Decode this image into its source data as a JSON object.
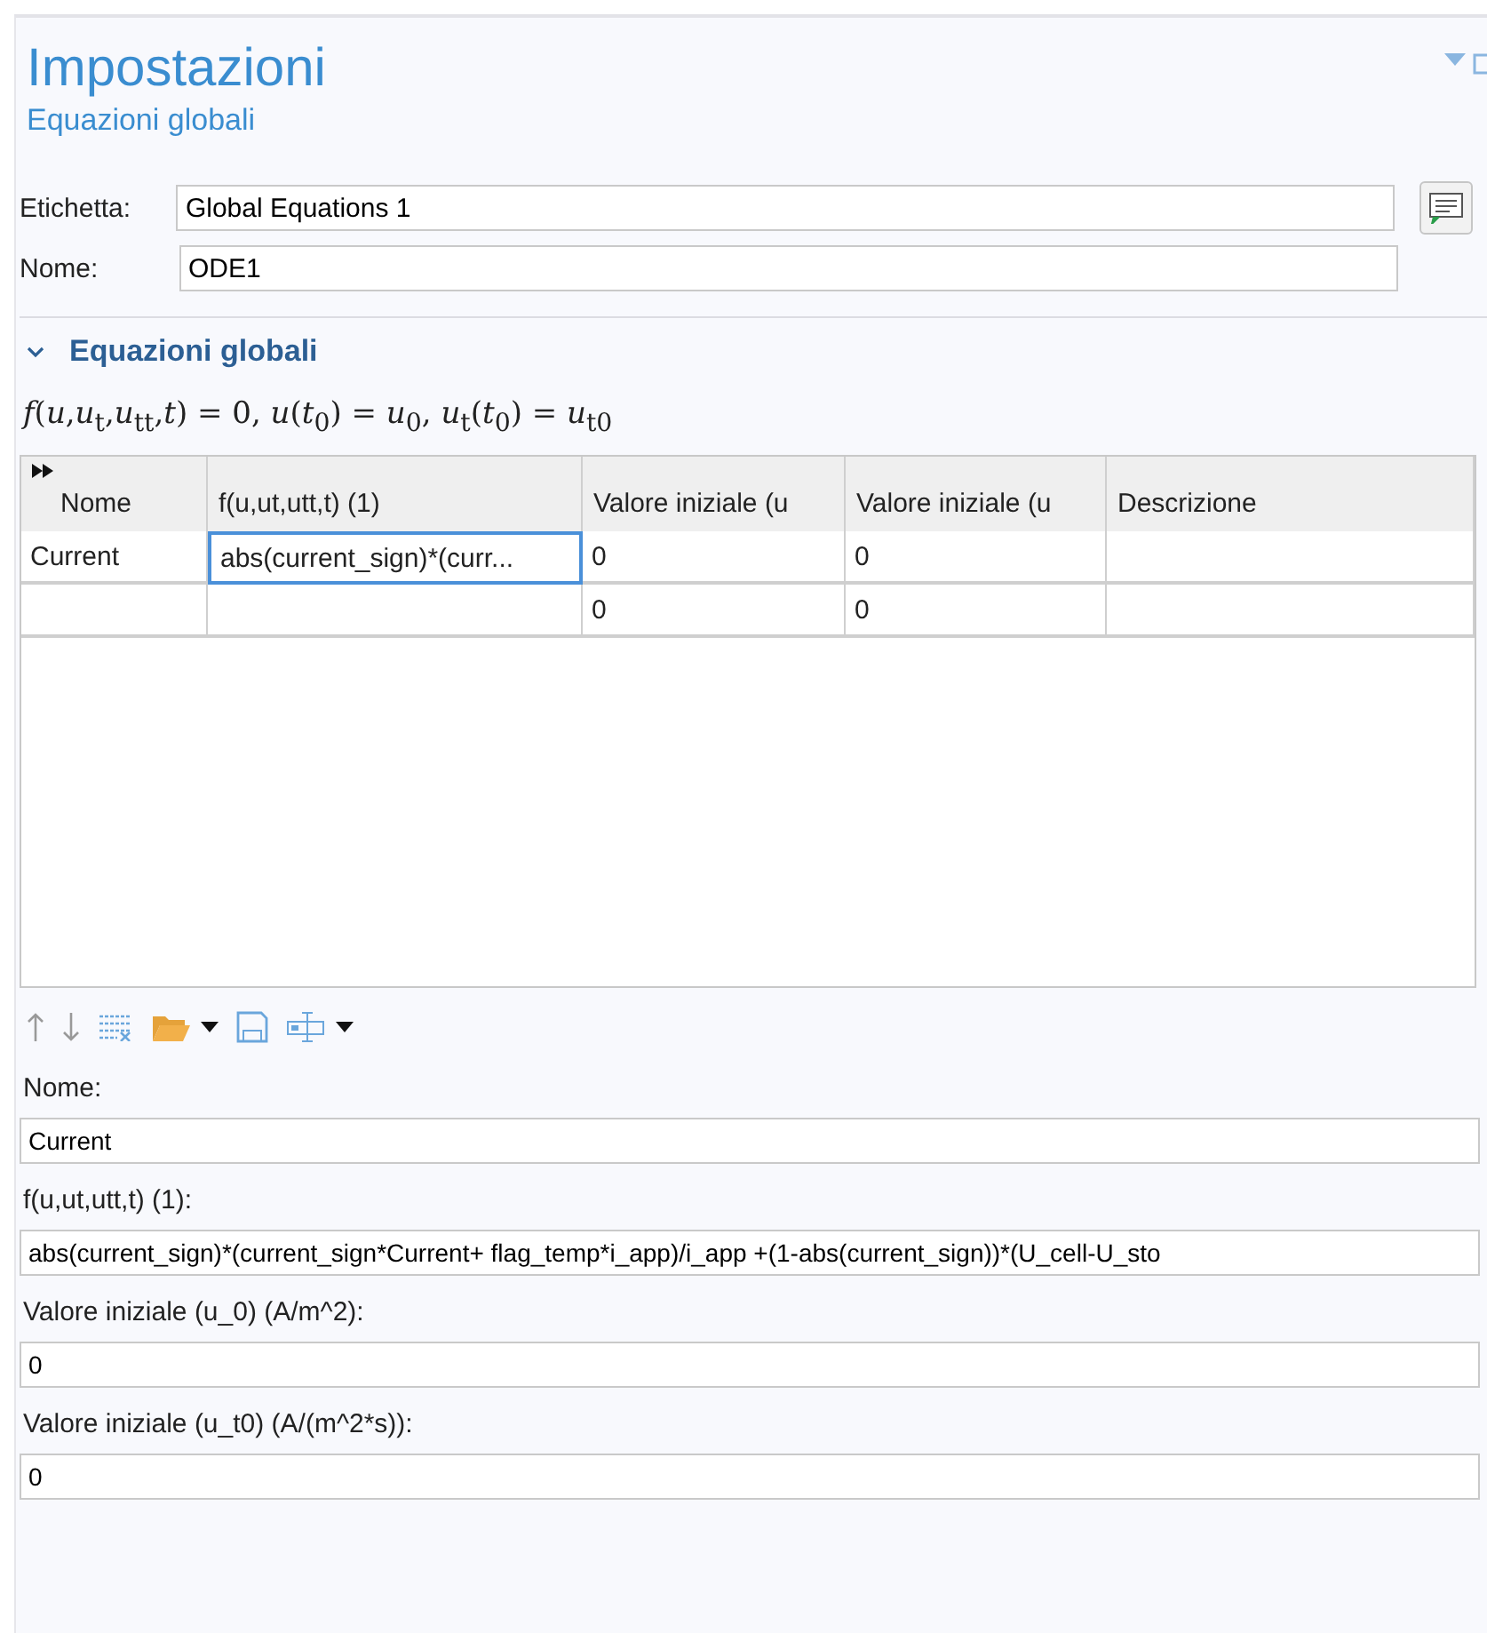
{
  "title": "Impostazioni",
  "subtitle": "Equazioni globali",
  "fields": [
    {
      "label": "Etichetta:",
      "value": "Global Equations 1",
      "kind": "with-button"
    },
    {
      "label": "Nome:",
      "value": "ODE1",
      "kind": "plain"
    }
  ],
  "section": {
    "title": "Equazioni globali",
    "expanded": true
  },
  "equation": "*f*(*u*,*u*$_{t}$,*u*$_{tt}$,*t*) = 0,  *u*(*t*$_{0}$) = *u*$_{0}$,  *u*$_{t}$(*t*$_{0}$) = *u*$_{t0}$",
  "table": {
    "columns": [
      "Nome",
      "f(u,ut,utt,t) (1)",
      "Valore iniziale (u",
      "Valore iniziale (u",
      "Descrizione"
    ],
    "rows": [
      {
        "cells": [
          {
            "text": "Current",
            "selected": false
          },
          {
            "text": "abs(current_sign)*(curr...",
            "selected": true
          },
          {
            "text": "0",
            "selected": false
          },
          {
            "text": "0",
            "selected": false
          },
          {
            "selected": false
          }
        ]
      },
      {
        "cells": [
          {
            "selected": false
          },
          {
            "selected": false
          },
          {
            "text": "0",
            "selected": false
          },
          {
            "text": "0",
            "selected": false
          },
          {
            "selected": false
          }
        ]
      }
    ]
  },
  "editor": [
    {
      "label": "Nome:",
      "value": "Current"
    },
    {
      "label": "f(u,ut,utt,t) (1):",
      "value": "abs(current_sign)*(current_sign*Current+ flag_temp*i_app)/i_app +(1-abs(current_sign))*(U_cell-U_sto"
    },
    {
      "label": "Valore iniziale (u_0) (A/m^2):",
      "value": "0"
    },
    {
      "label": "Valore iniziale (u_t0) (A/(m^2*s)):",
      "value": "0"
    }
  ]
}
